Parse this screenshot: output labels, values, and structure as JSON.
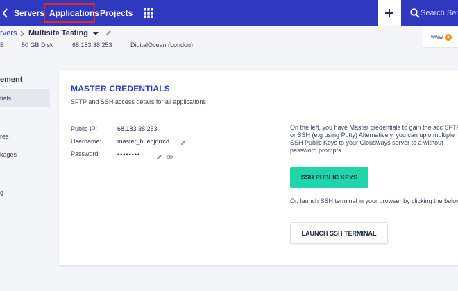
{
  "colors": {
    "header_bg": "#2f39bf",
    "accent": "#2f39bf",
    "ssh_button": "#1ed6aa",
    "highlight_box": "#e0292d",
    "badge": "#f28c21"
  },
  "nav": {
    "items": [
      {
        "label": "Servers"
      },
      {
        "label": "Applications",
        "highlighted": true
      },
      {
        "label": "Projects"
      }
    ],
    "icons": [
      "chevron-icon",
      "grid-icon",
      "plus-icon",
      "search-icon"
    ],
    "search_placeholder": "Search Server"
  },
  "breadcrumb": {
    "parent": "rvers",
    "current": "Multisite Testing"
  },
  "server_meta": [
    "B",
    "50 GB Disk",
    "68.183.38.253",
    "DigitalOcean (London)"
  ],
  "www_widget": {
    "label": "www",
    "badge": "1"
  },
  "sidebar": {
    "heading": "ement",
    "active": "tials",
    "items": [
      "res",
      "kages",
      "g"
    ]
  },
  "card": {
    "title": "MASTER CREDENTIALS",
    "subtitle": "SFTP and SSH access details for all applications",
    "fields": [
      {
        "label": "Public IP:",
        "value": "68.183.38.253"
      },
      {
        "label": "Username:",
        "value": "master_huebjqrrcd"
      },
      {
        "label": "Password:",
        "value": "••••••••"
      }
    ],
    "info_text": "On the left, you have Master credentials to gain the acc SFTP or SSH (e.g using Putty) Alternatively, you can uplo multiple SSH Public Keys to your Cloudways server to a without password prompts.",
    "ssh_keys_button": "SSH PUBLIC KEYS",
    "terminal_text": "Or, launch SSH terminal in your browser by clicking the below.",
    "terminal_button": "LAUNCH SSH TERMINAL"
  }
}
